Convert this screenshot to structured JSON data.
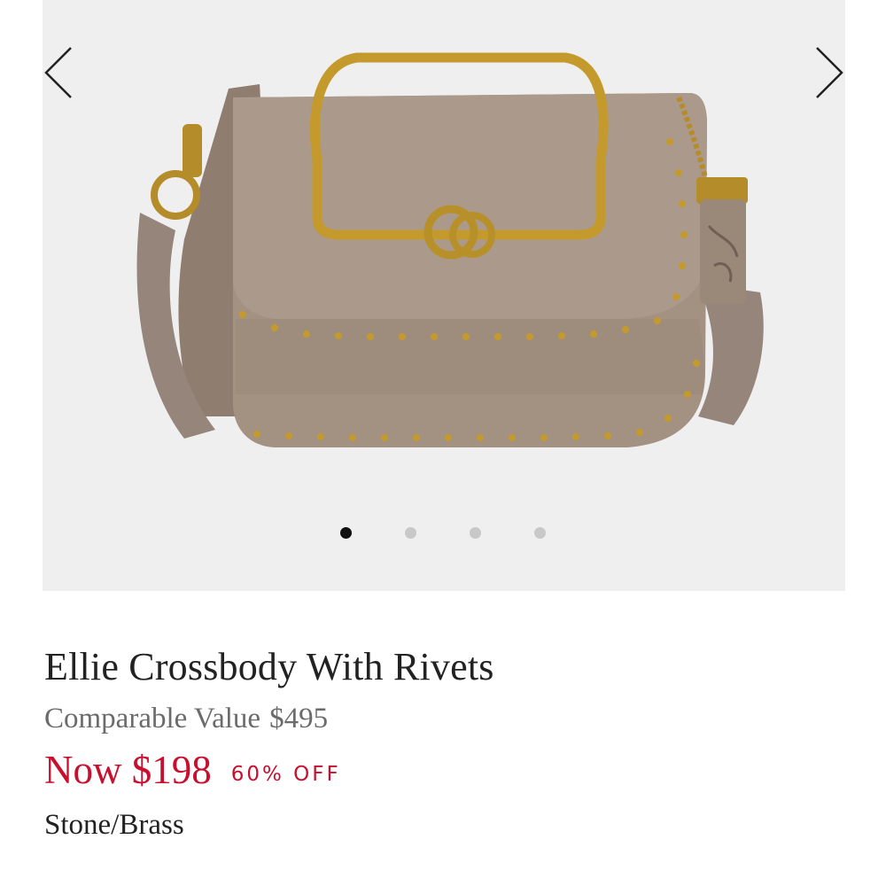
{
  "carousel": {
    "prev_icon": "chevron-left-icon",
    "next_icon": "chevron-right-icon",
    "image_alt": "bag-photo",
    "slide_count": 4,
    "active_slide": 1
  },
  "product": {
    "title": "Ellie Crossbody With Rivets",
    "comparable_label": "Comparable Value",
    "comparable_price": "$495",
    "now_price": "Now $198",
    "discount": "60% OFF",
    "color": "Stone/Brass"
  },
  "colors": {
    "sale_red": "#c8102e",
    "bag_taupe": "#9a8878",
    "hardware_brass": "#c49a2c"
  }
}
